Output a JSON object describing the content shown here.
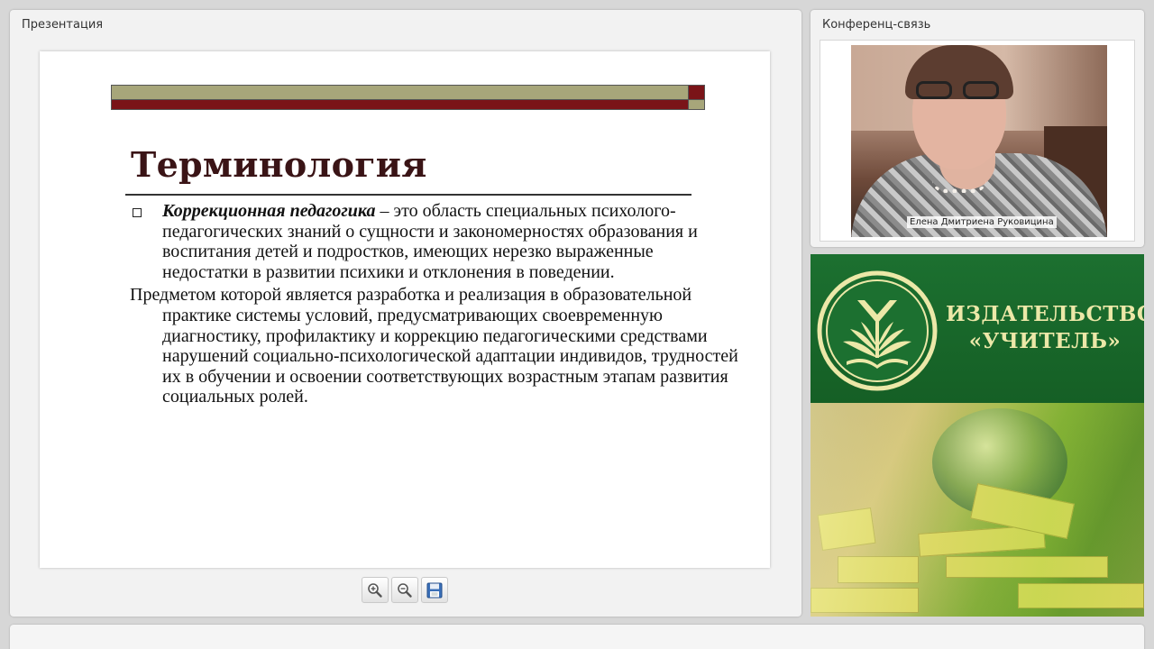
{
  "presentation": {
    "title": "Презентация",
    "slide": {
      "heading": "Терминология",
      "bullet_term": "Коррекционная педагогика",
      "bullet_text": " – это область специальных психолого-педагогических знаний о сущности и закономерностях образования и воспитания детей и подростков, имеющих нерезко выраженные недостатки в развитии психики и отклонения в поведении.",
      "paragraph": "Предметом которой является разработка и реализация в образовательной практике системы условий, предусматривающих своевременную диагностику, профилактику и коррекцию педагогическими средствами нарушений социально-психологической адаптации индивидов, трудностей их в обучении и освоении соответствующих возрастным этапам развития социальных ролей."
    },
    "toolbar": {
      "zoom_in_icon": "zoom-in-icon",
      "zoom_out_icon": "zoom-out-icon",
      "save_icon": "floppy-disk-icon"
    }
  },
  "conference": {
    "title": "Конференц-связь",
    "speaker_name": "Елена Дмитриена Руковицина"
  },
  "publisher": {
    "line1": "ИЗДАТЕЛЬСТВО",
    "line2": "«УЧИТЕЛЬ»"
  },
  "colors": {
    "slide_title": "#3a1416",
    "bar_olive": "#a7a67a",
    "bar_red": "#7a1418",
    "banner_green": "#1a6b2c",
    "banner_text": "#ece8a8"
  }
}
